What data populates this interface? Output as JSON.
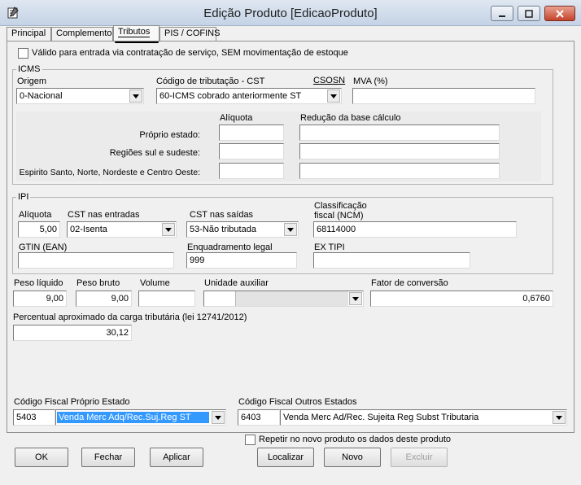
{
  "window": {
    "title": "Edição Produto [EdicaoProduto]"
  },
  "tabs": [
    {
      "label": "Principal"
    },
    {
      "label": "Complemento"
    },
    {
      "label": "Tributos"
    },
    {
      "label": "PIS / COFINS"
    }
  ],
  "service_checkbox_label": "Válido para entrada via contratação de serviço, SEM movimentação de estoque",
  "icms": {
    "group_label": "ICMS",
    "origem_label": "Origem",
    "origem_value": "0-Nacional",
    "cst_label": "Código de tributação - CST",
    "cst_value": "60-ICMS cobrado anteriormente ST",
    "csosn_label": "CSOSN",
    "mva_label": "MVA (%)",
    "mva_value": "",
    "aliquota_label": "Alíquota",
    "reducao_label": "Redução da base cálculo",
    "rows": [
      {
        "label": "Próprio estado:",
        "aliquota": "",
        "reducao": ""
      },
      {
        "label": "Regiões sul e sudeste:",
        "aliquota": "",
        "reducao": ""
      },
      {
        "label": "Espirito Santo, Norte, Nordeste e Centro Oeste:",
        "aliquota": "",
        "reducao": ""
      }
    ]
  },
  "ipi": {
    "group_label": "IPI",
    "aliquota_label": "Alíquota",
    "aliquota_value": "5,00",
    "cst_entradas_label": "CST nas entradas",
    "cst_entradas_value": "02-Isenta",
    "cst_saidas_label": "CST nas saídas",
    "cst_saidas_value": "53-Não tributada",
    "ncm_label_line1": "Classificação",
    "ncm_label_line2": "fiscal (NCM)",
    "ncm_value": "68114000",
    "gtin_label": "GTIN (EAN)",
    "gtin_value": "",
    "enquadramento_label": "Enquadramento legal",
    "enquadramento_value": "999",
    "extipi_label": "EX TIPI",
    "extipi_value": ""
  },
  "peso": {
    "liquido_label": "Peso líquido",
    "liquido_value": "9,00",
    "bruto_label": "Peso bruto",
    "bruto_value": "9,00",
    "volume_label": "Volume",
    "volume_value": "",
    "unidade_label": "Unidade auxiliar",
    "unidade_value": "",
    "fator_label": "Fator de conversão",
    "fator_value": "0,6760"
  },
  "carga": {
    "label": "Percentual aproximado da carga tributária (lei 12741/2012)",
    "value": "30,12"
  },
  "cfop": {
    "proprio_label": "Código Fiscal Próprio Estado",
    "proprio_code": "5403",
    "proprio_desc": "Venda Merc Adq/Rec.Suj.Reg ST",
    "outros_label": "Código Fiscal Outros Estados",
    "outros_code": "6403",
    "outros_desc": "Venda Merc Ad/Rec. Sujeita Reg Subst Tributaria"
  },
  "repetir_label": "Repetir no novo produto os dados deste produto",
  "buttons": {
    "ok": "OK",
    "fechar": "Fechar",
    "aplicar": "Aplicar",
    "localizar": "Localizar",
    "novo": "Novo",
    "excluir": "Excluir"
  },
  "colors": {
    "selection": "#3399ff",
    "close_button": "#c4432c",
    "titlebar": "#c4d3e6"
  }
}
